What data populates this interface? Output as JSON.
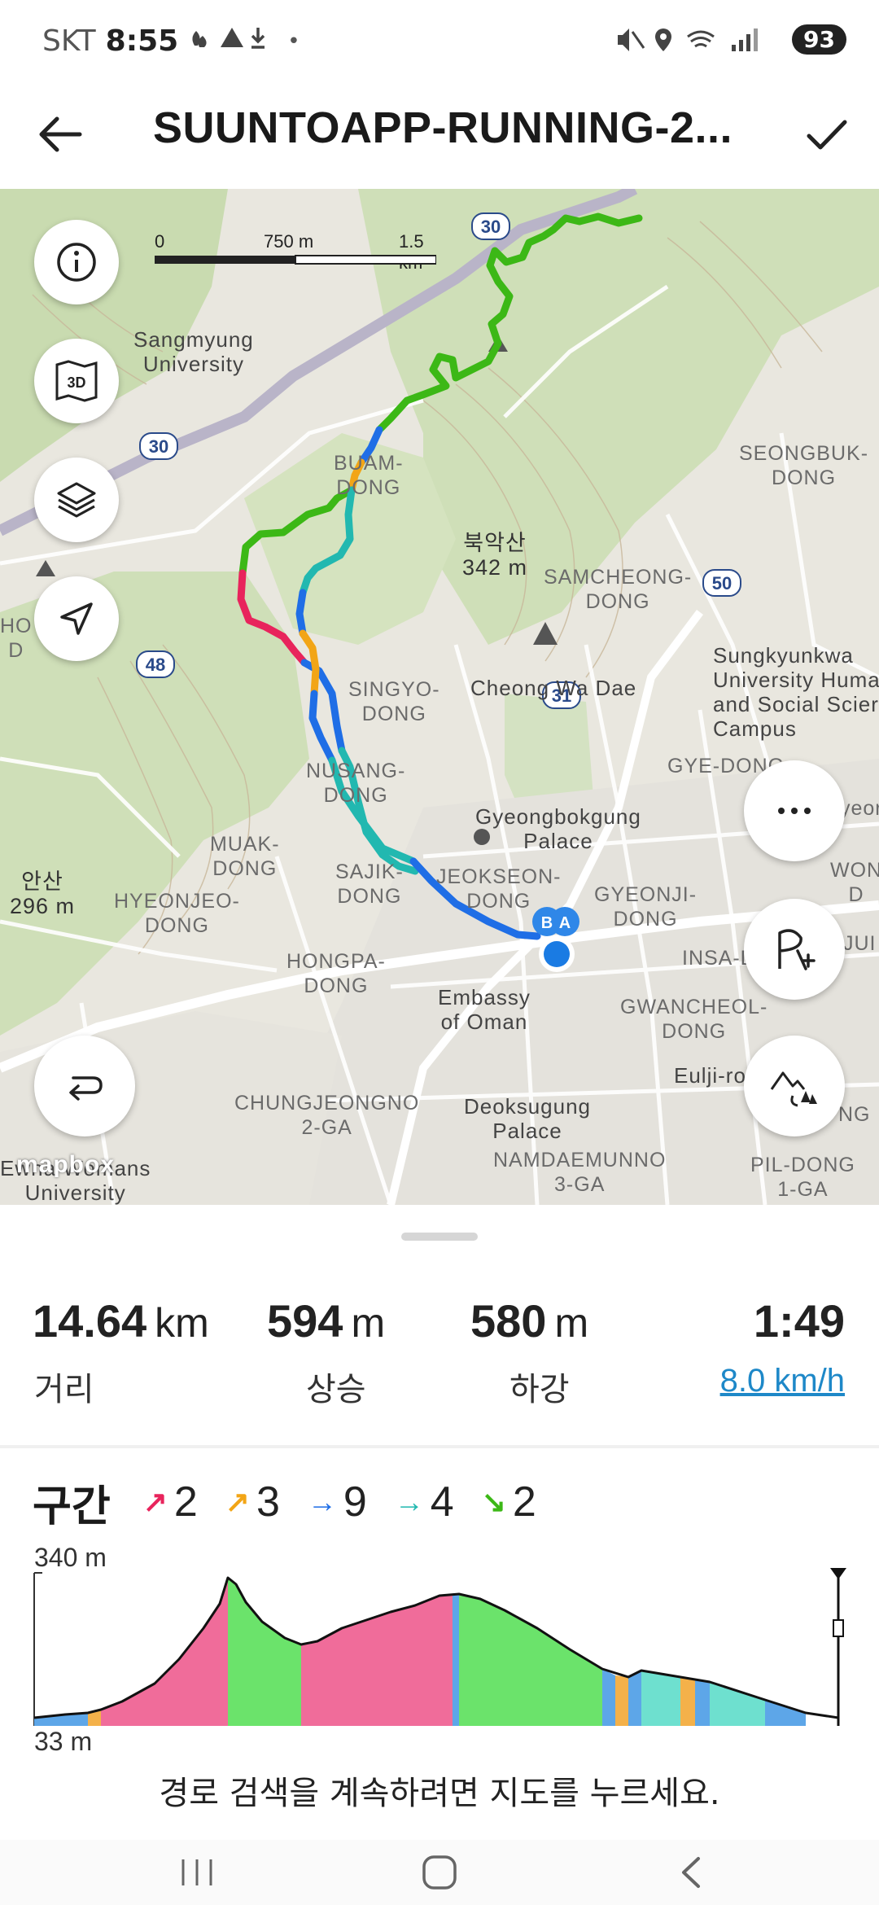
{
  "status_bar": {
    "carrier": "SKT",
    "time": "8:55",
    "battery": "93"
  },
  "app_bar": {
    "title": "SUUNTOAPP-RUNNING-2..."
  },
  "map": {
    "scale": {
      "zero": "0",
      "mid": "750 m",
      "end": "1.5 km"
    },
    "road_badges": [
      "30",
      "30",
      "50",
      "48",
      "31"
    ],
    "labels": {
      "sangmyung": "Sangmyung\nUniversity",
      "buam": "BUAM-\nDONG",
      "seongbuk": "SEONGBUK-\nDONG",
      "bugaksan": "북악산\n342 m",
      "samcheong": "SAMCHEONG-\nDONG",
      "singyo": "SINGYO-\nDONG",
      "cheongwadae": "Cheong Wa Dae",
      "sungkyunkwan": "Sungkyunkwa\nUniversity Huma\nand Social Scier\nCampus",
      "nusang": "NUSANG-\nDONG",
      "gyedong": "GYE-DONG",
      "gyeongbokgung": "Gyeongbokgung\nPalace",
      "muak": "MUAK-\nDONG",
      "jeokseon": "JEOKSEON-\nDONG",
      "gyeonji": "GYEONJI-\nDONG",
      "ansan": "안산\n296 m",
      "hyeonjeo": "HYEONJEO-\nDONG",
      "sajik": "SAJIK-\nDONG",
      "hongpa": "HONGPA-\nDONG",
      "insa": "INSA-DO",
      "oman": "Embassy\nof Oman",
      "gwancheol": "GWANCHEOL-\nDONG",
      "eulji": "Eulji-ro",
      "chungjeong": "CHUNGJEONGNO\n2-GA",
      "deoksu": "Deoksugung\nPalace",
      "namdaemun": "NAMDAEMUNNO\n3-GA",
      "pildong": "PIL-DONG\n1-GA",
      "womans": "Ewha Womans\nUniversity",
      "mapbox": "mapbox",
      "leftedge_a": "HO\nD",
      "rightedge_a": "WON\nD",
      "rightedge_b": "JUI",
      "rightedge_c": "NG",
      "rightedge_d": "yeor"
    },
    "route_colors": {
      "steep_up": "#e8245c",
      "up": "#f2a516",
      "flat": "#1f6ee6",
      "down": "#22b8b0",
      "steep_down": "#3cb816"
    }
  },
  "summary": {
    "distance_value": "14.64",
    "distance_unit": "km",
    "distance_label": "거리",
    "ascent_value": "594",
    "ascent_unit": "m",
    "ascent_label": "상승",
    "descent_value": "580",
    "descent_unit": "m",
    "descent_label": "하강",
    "duration": "1:49",
    "speed": "8.0 km/h"
  },
  "segments": {
    "title": "구간",
    "items": [
      {
        "arrow": "↗",
        "count": "2",
        "color": "#e8245c"
      },
      {
        "arrow": "↗",
        "count": "3",
        "color": "#f2a516"
      },
      {
        "arrow": "→",
        "count": "9",
        "color": "#1f6ee6"
      },
      {
        "arrow": "→",
        "count": "4",
        "color": "#22b8b0"
      },
      {
        "arrow": "↘",
        "count": "2",
        "color": "#3cb816"
      }
    ]
  },
  "profile": {
    "max_label": "340 m",
    "min_label": "33 m",
    "max_m": 340,
    "min_m": 33
  },
  "hint": "경로 검색을 계속하려면 지도를 누르세요."
}
